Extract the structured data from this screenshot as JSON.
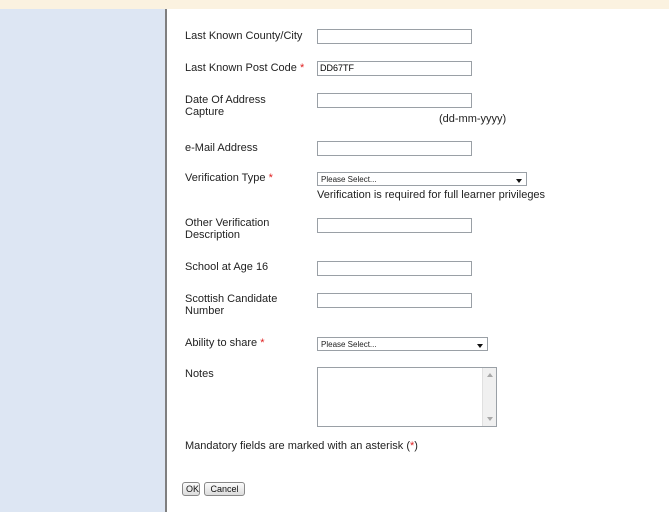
{
  "form": {
    "county": {
      "label": "Last Known County/City",
      "value": ""
    },
    "postcode": {
      "label": "Last Known Post Code",
      "required_mark": "*",
      "value": "DD67TF"
    },
    "date_capture": {
      "label": "Date Of Address Capture",
      "value": "",
      "hint": "(dd-mm-yyyy)"
    },
    "email": {
      "label": "e-Mail Address",
      "value": ""
    },
    "verification_type": {
      "label": "Verification Type",
      "required_mark": "*",
      "selected": "Please Select...",
      "hint": "Verification is required for full learner privileges"
    },
    "other_verification": {
      "label": "Other Verification Description",
      "value": ""
    },
    "school": {
      "label": "School at Age 16",
      "value": ""
    },
    "scottish_candidate": {
      "label": "Scottish Candidate Number",
      "value": ""
    },
    "ability_share": {
      "label": "Ability to share",
      "required_mark": "*",
      "selected": "Please Select..."
    },
    "notes": {
      "label": "Notes",
      "value": ""
    }
  },
  "mandatory_note": {
    "text": "Mandatory fields are marked with an asterisk (",
    "mark": "*",
    "close": ")"
  },
  "buttons": {
    "ok": "OK",
    "cancel": "Cancel"
  },
  "colors": {
    "sidebar": "#dde6f3",
    "required": "#e02020",
    "top_strip": "#fbf2e0"
  }
}
